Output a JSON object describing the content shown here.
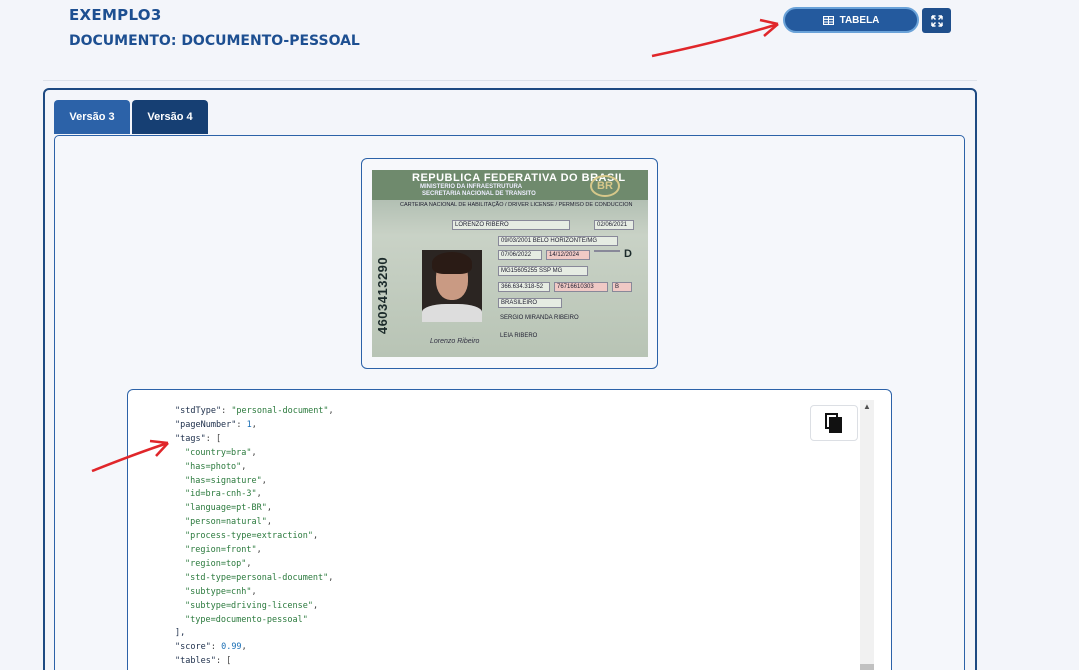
{
  "header": {
    "title": "EXEMPLO3",
    "document_label": "DOCUMENTO:",
    "document_value": "DOCUMENTO-PESSOAL"
  },
  "toolbar": {
    "table_button_label": "TABELA",
    "table_icon": "table-icon",
    "expand_icon": "expand-icon"
  },
  "tabs": [
    {
      "label": "Versão 3"
    },
    {
      "label": "Versão 4"
    }
  ],
  "id_card": {
    "line1": "REPUBLICA FEDERATIVA DO BRASIL",
    "line2": "MINISTERIO DA INFRAESTRUTURA",
    "line3": "SECRETARIA NACIONAL DE TRANSITO",
    "seal": "BR",
    "subtitle": "CARTEIRA NACIONAL DE HABILITAÇÃO / DRIVER LICENSE / PERMISO DE CONDUCCION",
    "name": "LORENZO RIBERO",
    "first_license_date": "02/06/2021",
    "birth": "09/03/2001 BELO HORIZONTE/MG",
    "issue_date": "07/06/2022",
    "validity": "14/12/2024",
    "category": "D",
    "rg": "MG15605255  SSP  MG",
    "cpf": "366.634.318-52",
    "registry": "76716610303",
    "nationality": "BRASILEIRO",
    "father": "SERGIO MIRANDA RIBEIRO",
    "mother": "LEIA RIBERO",
    "vertical_number": "4603413290",
    "signature": "Lorenzo Ribeiro",
    "category_code": "B"
  },
  "json_view": {
    "copy_icon": "copy-icon",
    "lines": [
      {
        "key": "\"stdType\"",
        "sep": ": ",
        "val": "\"personal-document\"",
        "tail": ","
      },
      {
        "key": "\"pageNumber\"",
        "sep": ": ",
        "val": "1",
        "tail": ","
      },
      {
        "key": "\"tags\"",
        "sep": ": [",
        "val": "",
        "tail": ""
      },
      {
        "val": "\"country=bra\"",
        "tail": ","
      },
      {
        "val": "\"has=photo\"",
        "tail": ","
      },
      {
        "val": "\"has=signature\"",
        "tail": ","
      },
      {
        "val": "\"id=bra-cnh-3\"",
        "tail": ","
      },
      {
        "val": "\"language=pt-BR\"",
        "tail": ","
      },
      {
        "val": "\"person=natural\"",
        "tail": ","
      },
      {
        "val": "\"process-type=extraction\"",
        "tail": ","
      },
      {
        "val": "\"region=front\"",
        "tail": ","
      },
      {
        "val": "\"region=top\"",
        "tail": ","
      },
      {
        "val": "\"std-type=personal-document\"",
        "tail": ","
      },
      {
        "val": "\"subtype=cnh\"",
        "tail": ","
      },
      {
        "val": "\"subtype=driving-license\"",
        "tail": ","
      },
      {
        "val": "\"type=documento-pessoal\"",
        "tail": ""
      },
      {
        "key": "],",
        "sep": "",
        "val": "",
        "tail": ""
      },
      {
        "key": "\"score\"",
        "sep": ": ",
        "val": "0.99",
        "tail": ","
      },
      {
        "key": "\"tables\"",
        "sep": ": [",
        "val": "",
        "tail": ""
      }
    ]
  },
  "colors": {
    "primary": "#245a9e",
    "dark": "#163f73",
    "annotation_arrow": "#e0262a"
  }
}
